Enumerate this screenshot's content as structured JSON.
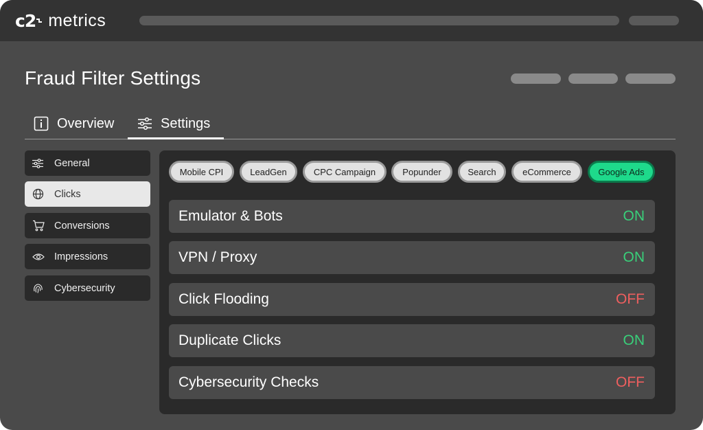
{
  "app": {
    "logo_mark": "c2",
    "logo_text": "metrics"
  },
  "page": {
    "title": "Fraud Filter Settings"
  },
  "tabs": [
    {
      "label": "Overview",
      "icon": "info-icon",
      "active": false
    },
    {
      "label": "Settings",
      "icon": "sliders-icon",
      "active": true
    }
  ],
  "sidebar": {
    "items": [
      {
        "label": "General",
        "icon": "sliders-icon",
        "active": false
      },
      {
        "label": "Clicks",
        "icon": "globe-icon",
        "active": true
      },
      {
        "label": "Conversions",
        "icon": "cart-icon",
        "active": false
      },
      {
        "label": "Impressions",
        "icon": "eye-icon",
        "active": false
      },
      {
        "label": "Cybersecurity",
        "icon": "fingerprint-icon",
        "active": false
      }
    ]
  },
  "campaign_types": [
    {
      "label": "Mobile CPI",
      "active": false
    },
    {
      "label": "LeadGen",
      "active": false
    },
    {
      "label": "CPC Campaign",
      "active": false
    },
    {
      "label": "Popunder",
      "active": false
    },
    {
      "label": "Search",
      "active": false
    },
    {
      "label": "eCommerce",
      "active": false
    },
    {
      "label": "Google Ads",
      "active": true
    }
  ],
  "rules": [
    {
      "name": "Emulator & Bots",
      "status": "ON"
    },
    {
      "name": "VPN / Proxy",
      "status": "ON"
    },
    {
      "name": "Click Flooding",
      "status": "OFF"
    },
    {
      "name": "Duplicate Clicks",
      "status": "ON"
    },
    {
      "name": "Cybersecurity Checks",
      "status": "OFF"
    }
  ],
  "colors": {
    "on": "#39d07a",
    "off": "#ef5f5f",
    "accent": "#1ed98b"
  }
}
